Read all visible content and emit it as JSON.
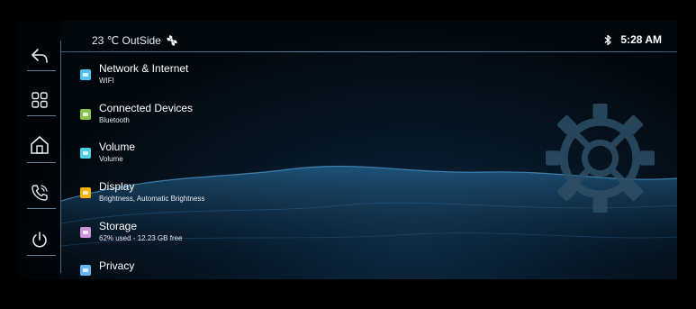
{
  "status_bar": {
    "temperature": "23 ℃ OutSide",
    "time": "5:28 AM"
  },
  "sidebar": {
    "items": [
      {
        "icon": "back-arrow-icon"
      },
      {
        "icon": "apps-grid-icon"
      },
      {
        "icon": "home-icon"
      },
      {
        "icon": "phone-icon"
      },
      {
        "icon": "power-icon"
      }
    ]
  },
  "menu": {
    "items": [
      {
        "title": "Network & Internet",
        "subtitle": "WIFI",
        "color": "#4fc3f7"
      },
      {
        "title": "Connected Devices",
        "subtitle": "Bluetooth",
        "color": "#8bc34a"
      },
      {
        "title": "Volume",
        "subtitle": "Volume",
        "color": "#4dd0e1"
      },
      {
        "title": "Display",
        "subtitle": "Brightness, Automatic Brightness",
        "color": "#ffb300"
      },
      {
        "title": "Storage",
        "subtitle": "62% used - 12.23 GB free",
        "color": "#ce93d8"
      },
      {
        "title": "Privacy",
        "subtitle": "",
        "color": "#64b5f6"
      }
    ]
  },
  "colors": {
    "background": "#02070c",
    "accent": "#4fa7d8",
    "gear": "#2e4f66"
  }
}
